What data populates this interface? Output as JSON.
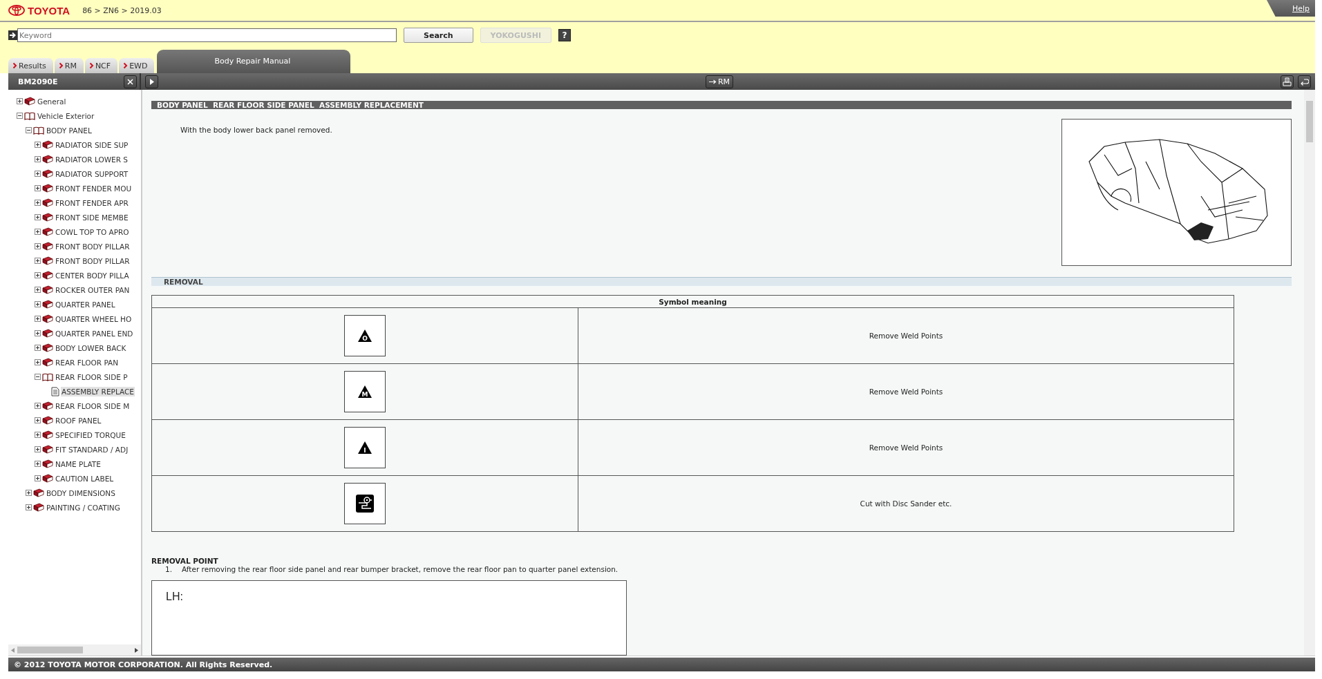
{
  "header": {
    "brand": "TOYOTA",
    "breadcrumb": "86 > ZN6 > 2019.03",
    "help": "Help"
  },
  "search": {
    "placeholder": "Keyword",
    "button": "Search",
    "yokogushi": {
      "label": "YOKOGUSHI",
      "disabled": true
    },
    "help_button": "?"
  },
  "tabs": [
    {
      "label": "Results",
      "selected": false
    },
    {
      "label": "RM",
      "selected": false
    },
    {
      "label": "NCF",
      "selected": false
    },
    {
      "label": "EWD",
      "selected": false
    },
    {
      "label": "Body Repair Manual",
      "selected": true
    }
  ],
  "tree": {
    "title": "BM2090E",
    "items": [
      {
        "label": "General",
        "kind": "book",
        "expanded": false,
        "selected": false
      },
      {
        "label": "Vehicle Exterior",
        "kind": "book",
        "expanded": true,
        "selected": false,
        "children": [
          {
            "label": "BODY PANEL",
            "kind": "book",
            "expanded": true,
            "selected": false,
            "children": [
              {
                "label": "RADIATOR SIDE SUP",
                "kind": "book",
                "expanded": false,
                "selected": false
              },
              {
                "label": "RADIATOR LOWER S",
                "kind": "book",
                "expanded": false,
                "selected": false
              },
              {
                "label": "RADIATOR SUPPORT",
                "kind": "book",
                "expanded": false,
                "selected": false
              },
              {
                "label": "FRONT FENDER MOU",
                "kind": "book",
                "expanded": false,
                "selected": false
              },
              {
                "label": "FRONT FENDER APR",
                "kind": "book",
                "expanded": false,
                "selected": false
              },
              {
                "label": "FRONT SIDE MEMBE",
                "kind": "book",
                "expanded": false,
                "selected": false
              },
              {
                "label": "COWL TOP TO APRO",
                "kind": "book",
                "expanded": false,
                "selected": false
              },
              {
                "label": "FRONT BODY PILLAR",
                "kind": "book",
                "expanded": false,
                "selected": false
              },
              {
                "label": "FRONT BODY PILLAR",
                "kind": "book",
                "expanded": false,
                "selected": false
              },
              {
                "label": "CENTER BODY PILLA",
                "kind": "book",
                "expanded": false,
                "selected": false
              },
              {
                "label": "ROCKER OUTER PAN",
                "kind": "book",
                "expanded": false,
                "selected": false
              },
              {
                "label": "QUARTER PANEL",
                "kind": "book",
                "expanded": false,
                "selected": false
              },
              {
                "label": "QUARTER WHEEL HO",
                "kind": "book",
                "expanded": false,
                "selected": false
              },
              {
                "label": "QUARTER PANEL END",
                "kind": "book",
                "expanded": false,
                "selected": false
              },
              {
                "label": "BODY LOWER BACK",
                "kind": "book",
                "expanded": false,
                "selected": false
              },
              {
                "label": "REAR FLOOR PAN",
                "kind": "book",
                "expanded": false,
                "selected": false
              },
              {
                "label": "REAR FLOOR SIDE P",
                "kind": "book",
                "expanded": true,
                "selected": false,
                "children": [
                  {
                    "label": "ASSEMBLY REPLACE",
                    "kind": "page",
                    "selected": true
                  }
                ]
              },
              {
                "label": "REAR FLOOR SIDE M",
                "kind": "book",
                "expanded": false,
                "selected": false
              },
              {
                "label": "ROOF PANEL",
                "kind": "book",
                "expanded": false,
                "selected": false
              },
              {
                "label": "SPECIFIED TORQUE",
                "kind": "book",
                "expanded": false,
                "selected": false
              },
              {
                "label": "FIT STANDARD / ADJ",
                "kind": "book",
                "expanded": false,
                "selected": false
              },
              {
                "label": "NAME PLATE",
                "kind": "book",
                "expanded": false,
                "selected": false
              },
              {
                "label": "CAUTION LABEL",
                "kind": "book",
                "expanded": false,
                "selected": false
              }
            ]
          },
          {
            "label": "BODY DIMENSIONS",
            "kind": "book",
            "expanded": false,
            "selected": false
          },
          {
            "label": "PAINTING / COATING",
            "kind": "book",
            "expanded": false,
            "selected": false
          }
        ]
      }
    ]
  },
  "toolbar": {
    "rm_button": "RM"
  },
  "document": {
    "title": "BODY PANEL  REAR FLOOR SIDE PANEL  ASSEMBLY REPLACEMENT",
    "note": "With the body lower back panel removed.",
    "section": "REMOVAL",
    "symbol_table": {
      "header": "Symbol meaning",
      "rows": [
        {
          "kind": "weld",
          "letter": "O",
          "meaning": "Remove Weld Points"
        },
        {
          "kind": "weld",
          "letter": "M",
          "meaning": "Remove Weld Points"
        },
        {
          "kind": "weld",
          "letter": "I",
          "meaning": "Remove Weld Points"
        },
        {
          "kind": "sander",
          "meaning": "Cut with Disc Sander etc."
        }
      ]
    },
    "removal_point": {
      "heading": "REMOVAL POINT",
      "steps": [
        {
          "number": "1.",
          "text": "After removing the rear floor side panel and rear bumper bracket, remove the rear floor pan to quarter panel extension."
        }
      ]
    },
    "figure_label": "LH:"
  },
  "footer": "© 2012 TOYOTA MOTOR CORPORATION. All Rights Reserved."
}
